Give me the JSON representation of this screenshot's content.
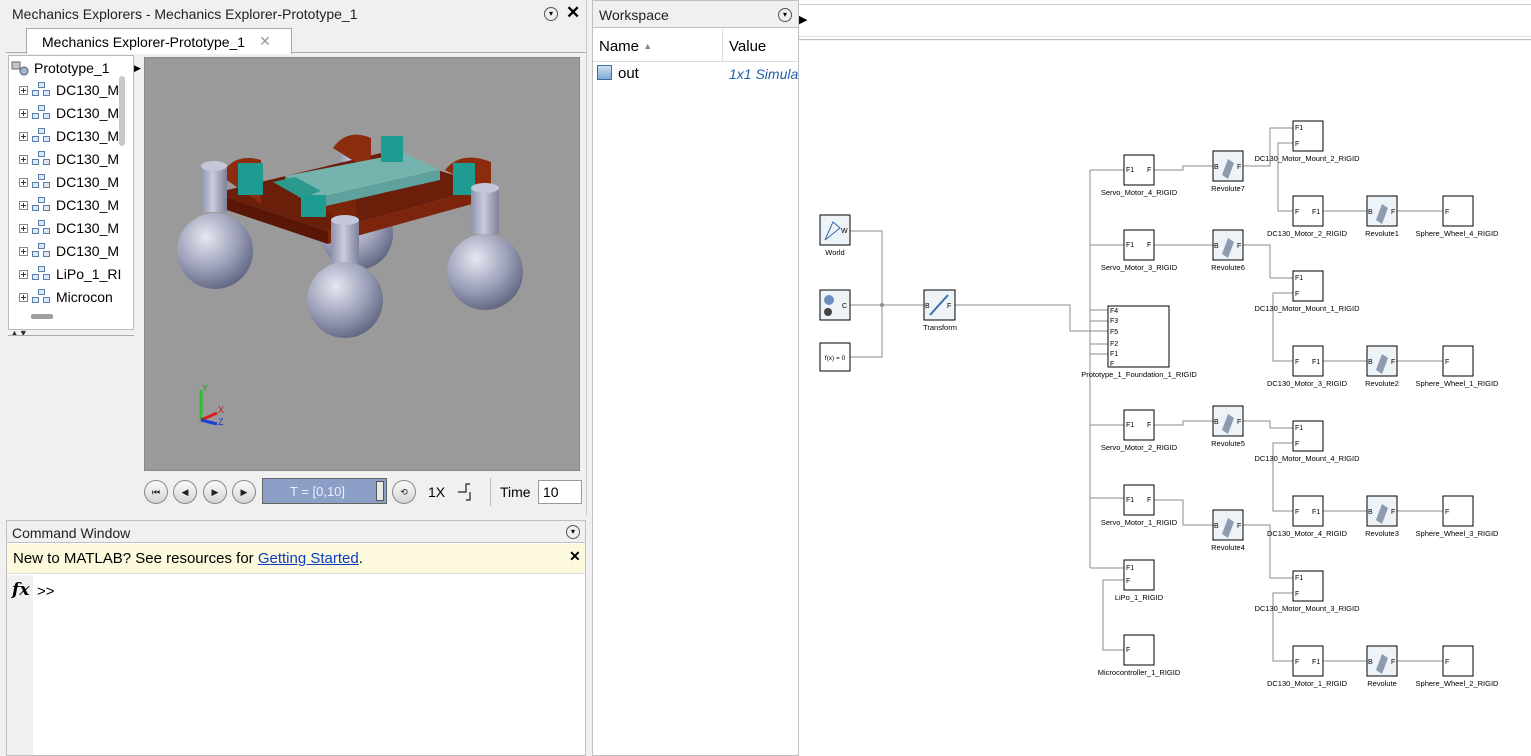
{
  "mechanics": {
    "window_title": "Mechanics Explorers - Mechanics Explorer-Prototype_1",
    "tab_label": "Mechanics Explorer-Prototype_1",
    "tree": [
      {
        "label": "Prototype_1"
      },
      {
        "label": "DC130_M"
      },
      {
        "label": "DC130_M"
      },
      {
        "label": "DC130_M"
      },
      {
        "label": "DC130_M"
      },
      {
        "label": "DC130_M"
      },
      {
        "label": "DC130_M"
      },
      {
        "label": "DC130_M"
      },
      {
        "label": "DC130_M"
      },
      {
        "label": "LiPo_1_RI"
      },
      {
        "label": "Microcon"
      }
    ],
    "axis_labels": {
      "y": "Y",
      "x": "X",
      "z": "Z"
    },
    "playback": {
      "time_range": "T = [0,10]",
      "speed": "1X",
      "time_label": "Time",
      "time_value": "10"
    }
  },
  "workspace": {
    "title": "Workspace",
    "columns": [
      "Name",
      "Value"
    ],
    "rows": [
      {
        "name": "out",
        "value": "1x1 Simula"
      }
    ]
  },
  "command_window": {
    "title": "Command Window",
    "banner_text": "New to MATLAB? See resources for ",
    "banner_link": "Getting Started",
    "banner_suffix": ".",
    "fx": "fx",
    "prompt": ">>"
  },
  "simulink": {
    "blocks": {
      "world": "World",
      "solver_fx": "f(x) = 0",
      "transform": "Transform",
      "foundation": "Prototype_1_Foundation_1_RIGID",
      "servo4": "Servo_Motor_4_RIGID",
      "servo3": "Servo_Motor_3_RIGID",
      "servo2": "Servo_Motor_2_RIGID",
      "servo1": "Servo_Motor_1_RIGID",
      "lipo": "LiPo_1_RIGID",
      "micro": "Microcontroller_1_RIGID",
      "rev7": "Revolute7",
      "rev6": "Revolute6",
      "rev5": "Revolute5",
      "rev4": "Revolute4",
      "rev1": "Revolute1",
      "rev2": "Revolute2",
      "rev3": "Revolute3",
      "rev": "Revolute",
      "mount2": "DC130_Motor_Mount_2_RIGID",
      "mount1": "DC130_Motor_Mount_1_RIGID",
      "mount4": "DC130_Motor_Mount_4_RIGID",
      "mount3": "DC130_Motor_Mount_3_RIGID",
      "motor2": "DC130_Motor_2_RIGID",
      "motor3": "DC130_Motor_3_RIGID",
      "motor4": "DC130_Motor_4_RIGID",
      "motor1": "DC130_Motor_1_RIGID",
      "wheel4": "Sphere_Wheel_4_RIGID",
      "wheel1": "Sphere_Wheel_1_RIGID",
      "wheel3": "Sphere_Wheel_3_RIGID",
      "wheel2": "Sphere_Wheel_2_RIGID"
    },
    "ports": {
      "f1": "F1",
      "f": "F",
      "f2": "F2",
      "f3": "F3",
      "f4": "F4",
      "f5": "F5",
      "b": "B",
      "c": "C",
      "w": "W"
    }
  }
}
